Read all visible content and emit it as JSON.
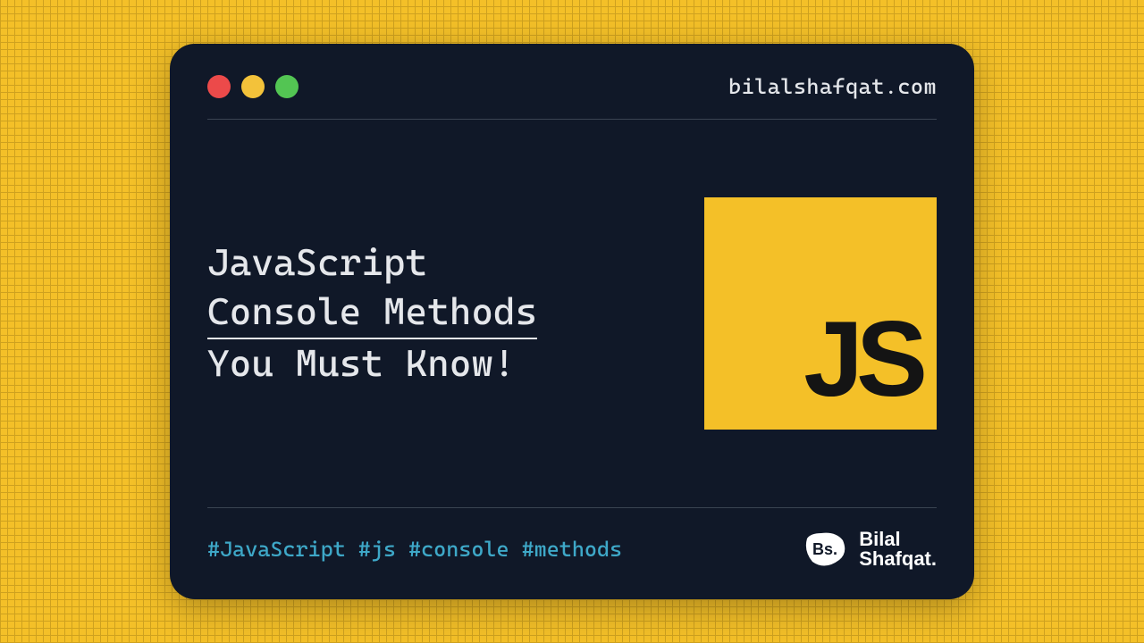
{
  "site": "bilalshafqat.com",
  "title": {
    "line1": "JavaScript",
    "line2": "Console Methods",
    "line3": "You Must Know!"
  },
  "jsLogo": "JS",
  "hashtags": "#JavaScript #js #console #methods",
  "brand": {
    "label": "Bs.",
    "line1": "Bilal",
    "line2": "Shafqat."
  },
  "colors": {
    "bg": "#f4c028",
    "card": "#101828",
    "red": "#ec4a4a",
    "yellow": "#f3c23a",
    "green": "#53c553",
    "hashtag": "#3ea8c8"
  }
}
